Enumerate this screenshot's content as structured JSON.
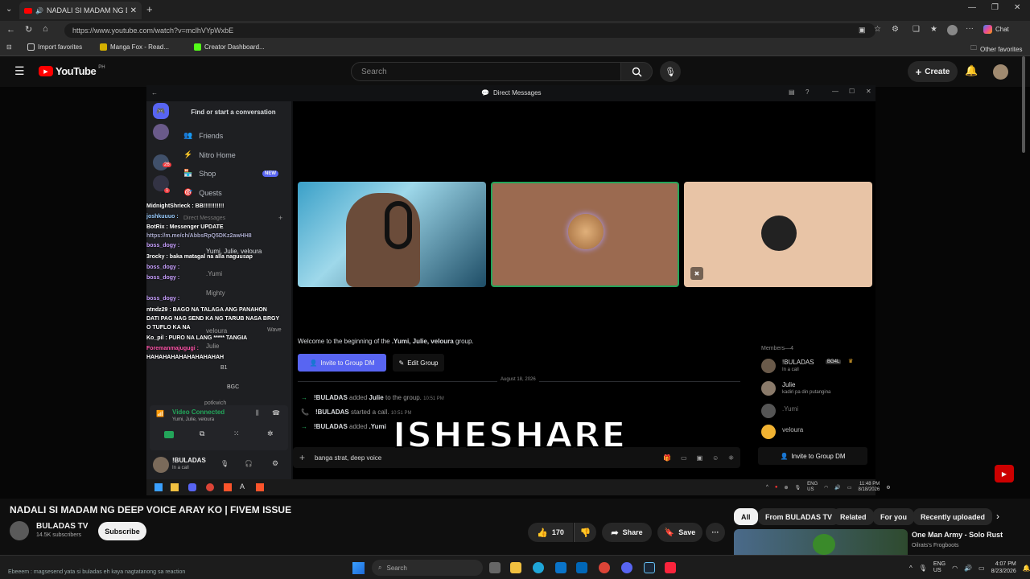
{
  "browser": {
    "tab_title": "NADALI SI MADAM NG DEEP",
    "url": "https://www.youtube.com/watch?v=mclhVYpWxbE",
    "favorites": [
      "Import favorites",
      "Manga Fox - Read...",
      "Creator Dashboard..."
    ],
    "other_favorites": "Other favorites",
    "chat_label": "Chat"
  },
  "youtube": {
    "logo_text": "YouTube",
    "region": "PH",
    "search_placeholder": "Search",
    "create_label": "Create"
  },
  "discord": {
    "window_title": "Direct Messages",
    "find_conversation": "Find or start a conversation",
    "nav": [
      "Friends",
      "Nitro Home",
      "Shop",
      "Quests"
    ],
    "shop_badge": "NEW",
    "server_badges": [
      "26",
      "1"
    ],
    "dm_header": "Direct Messages",
    "dm_group": "Yumi, Julie, veloura",
    "dm_names": [
      ".Yumi",
      "Mighty",
      "veloura",
      "Julie",
      "B1",
      "BGC",
      "potkwich"
    ],
    "overlay_chat": [
      "MidnightShrieck : BB!!!!!!!!!!!",
      "joshkuuuo :",
      "BotRix : Messenger UPDATE",
      "https://m.me/ch/AbbsRpQ5DKz2awHH8",
      "boss_dogy :",
      "3rocky : baka matagal na alla naguusap",
      "boss_dogy :",
      "boss_dogy :",
      "boss_dogy :",
      "ntndz29 : BAGO NA TALAGA ANG PANAHON",
      "DATI PAG NAG SEND KA NG TARUB NASA BRGY",
      "O TUFLO KA NA",
      "Ko_pil : PURO NA LANG ***** TANGIA",
      "Foremanmajugugi :",
      "HAHAHAHAHAHAHAHAHAH"
    ],
    "video_connected": "Video Connected",
    "vc_members": "Yumi, Julie, veloura",
    "user_name": "!BULADAS",
    "user_status": "In a call",
    "welcome_prefix": "Welcome to the beginning of the ",
    "welcome_group": ".Yumi, Julie, veloura",
    "welcome_suffix": " group.",
    "invite_label": "Invite to Group DM",
    "edit_label": "Edit Group",
    "date_divider": "August 18, 2026",
    "messages": [
      {
        "user": "!BULADAS",
        "action": "added",
        "target": "Julie",
        "rest": "to the group.",
        "time": "10:51 PM"
      },
      {
        "user": "!BULADAS",
        "action": "started a call.",
        "target": "",
        "rest": "",
        "time": "10:51 PM"
      },
      {
        "user": "!BULADAS",
        "action": "added",
        "target": ".Yumi",
        "rest": "",
        "time": ""
      }
    ],
    "composer_text": "banga strat, deep voice",
    "members_header": "Members—4",
    "members": [
      {
        "name": "!BULADAS",
        "tag": "BG4L",
        "status": "In a call"
      },
      {
        "name": "Julie",
        "tag": "",
        "status": "kadiri pa din putangina"
      },
      {
        "name": ".Yumi",
        "tag": "",
        "status": ""
      },
      {
        "name": "veloura",
        "tag": "",
        "status": ""
      }
    ],
    "members_invite": "Invite to Group DM",
    "inner_tray_lang": "ENG",
    "inner_tray_region": "US",
    "inner_clock_time": "11:48 PM",
    "inner_clock_date": "8/18/2026",
    "wave_label": "Wave"
  },
  "overlay_caption": "ISHESHARE",
  "video": {
    "title": "NADALI SI MADAM NG DEEP VOICE ARAY KO | FIVEM ISSUE",
    "channel": "BULADAS TV",
    "subscribers": "14.5K subscribers",
    "subscribe_label": "Subscribe",
    "likes": "170",
    "share_label": "Share",
    "save_label": "Save"
  },
  "chips": [
    "All",
    "From BULADAS TV",
    "Related",
    "For you",
    "Recently uploaded"
  ],
  "suggested": {
    "title": "One Man Army - Solo Rust",
    "channel": "Oilrats's Frogboots"
  },
  "windows": {
    "status_text": "Ebeeem : magsesend yata si buladas eh kaya nagtatanong sa reaction",
    "search_placeholder": "Search",
    "lang": "ENG",
    "region": "US",
    "time": "4:07 PM",
    "date": "8/23/2026"
  }
}
